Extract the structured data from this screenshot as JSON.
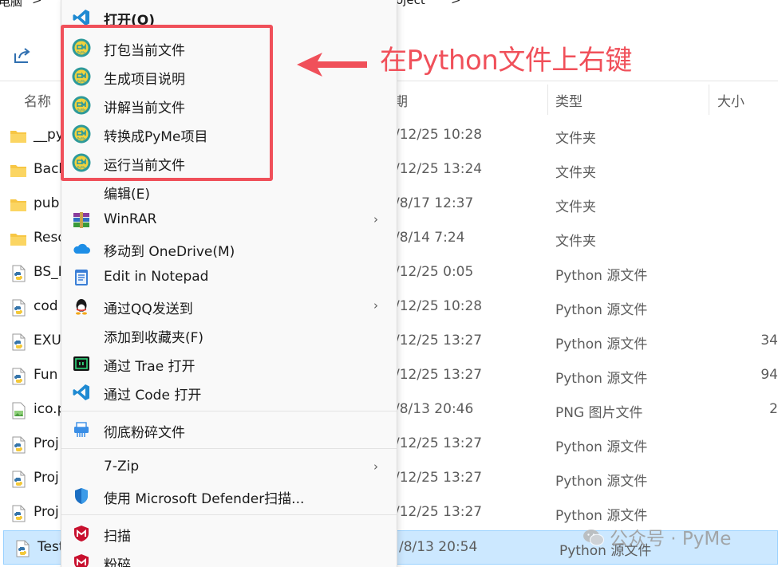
{
  "breadcrumb": {
    "left": "电脑",
    "right": "oject",
    "sep": ">"
  },
  "columns": {
    "name": "名称",
    "date": "日期",
    "type": "类型",
    "size": "大小"
  },
  "files": [
    {
      "name": "__py",
      "date": "/12/25 10:28",
      "type": "文件夹",
      "size": "",
      "icon": "folder-icon"
    },
    {
      "name": "Back",
      "date": "/12/25 13:24",
      "type": "文件夹",
      "size": "",
      "icon": "folder-icon"
    },
    {
      "name": "pub",
      "date": "/8/17 12:37",
      "type": "文件夹",
      "size": "",
      "icon": "folder-icon"
    },
    {
      "name": "Reso",
      "date": "/8/14 7:24",
      "type": "文件夹",
      "size": "",
      "icon": "folder-icon"
    },
    {
      "name": "BS_I",
      "date": "/12/25 0:05",
      "type": "Python 源文件",
      "size": "",
      "icon": "python-file-icon"
    },
    {
      "name": "cod",
      "date": "/12/25 10:28",
      "type": "Python 源文件",
      "size": "",
      "icon": "python-file-icon"
    },
    {
      "name": "EXU",
      "date": "/12/25 13:27",
      "type": "Python 源文件",
      "size": "34",
      "icon": "python-file-icon"
    },
    {
      "name": "Fun",
      "date": "/12/25 13:27",
      "type": "Python 源文件",
      "size": "94",
      "icon": "python-file-icon"
    },
    {
      "name": "ico.p",
      "date": "/8/13 20:46",
      "type": "PNG 图片文件",
      "size": "2",
      "icon": "png-file-icon"
    },
    {
      "name": "Proj",
      "date": "/12/25 13:27",
      "type": "Python 源文件",
      "size": "",
      "icon": "python-file-icon"
    },
    {
      "name": "Proj",
      "date": "/12/25 13:27",
      "type": "Python 源文件",
      "size": "",
      "icon": "python-file-icon"
    },
    {
      "name": "Proj",
      "date": "/12/25 13:27",
      "type": "Python 源文件",
      "size": "",
      "icon": "python-file-icon"
    },
    {
      "name": "Test",
      "date": "/8/13 20:54",
      "type": "Python 源文件",
      "size": "",
      "icon": "python-file-icon",
      "selected": true
    }
  ],
  "menu": {
    "open": "打开(O)",
    "pyme_items": [
      "打包当前文件",
      "生成项目说明",
      "讲解当前文件",
      "转换成PyMe项目",
      "运行当前文件"
    ],
    "edit": "编辑(E)",
    "winrar": "WinRAR",
    "onedrive": "移动到 OneDrive(M)",
    "notepad": "Edit in Notepad",
    "qq": "通过QQ发送到",
    "favorites": "添加到收藏夹(F)",
    "trae": "通过 Trae 打开",
    "code": "通过 Code 打开",
    "shred": "彻底粉碎文件",
    "zip": "7-Zip",
    "defender": "使用 Microsoft Defender扫描...",
    "scan": "扫描",
    "crush": "粉碎",
    "submenu_arrow": "›"
  },
  "annotation": {
    "text": "在Python文件上右键"
  },
  "watermark": {
    "text": "公众号 · PyMe"
  },
  "colors": {
    "accent_red": "#f0505a",
    "selection": "#cce8ff",
    "pyme_teal": "#2e9a9a",
    "pyme_yellow": "#f2d23c"
  }
}
